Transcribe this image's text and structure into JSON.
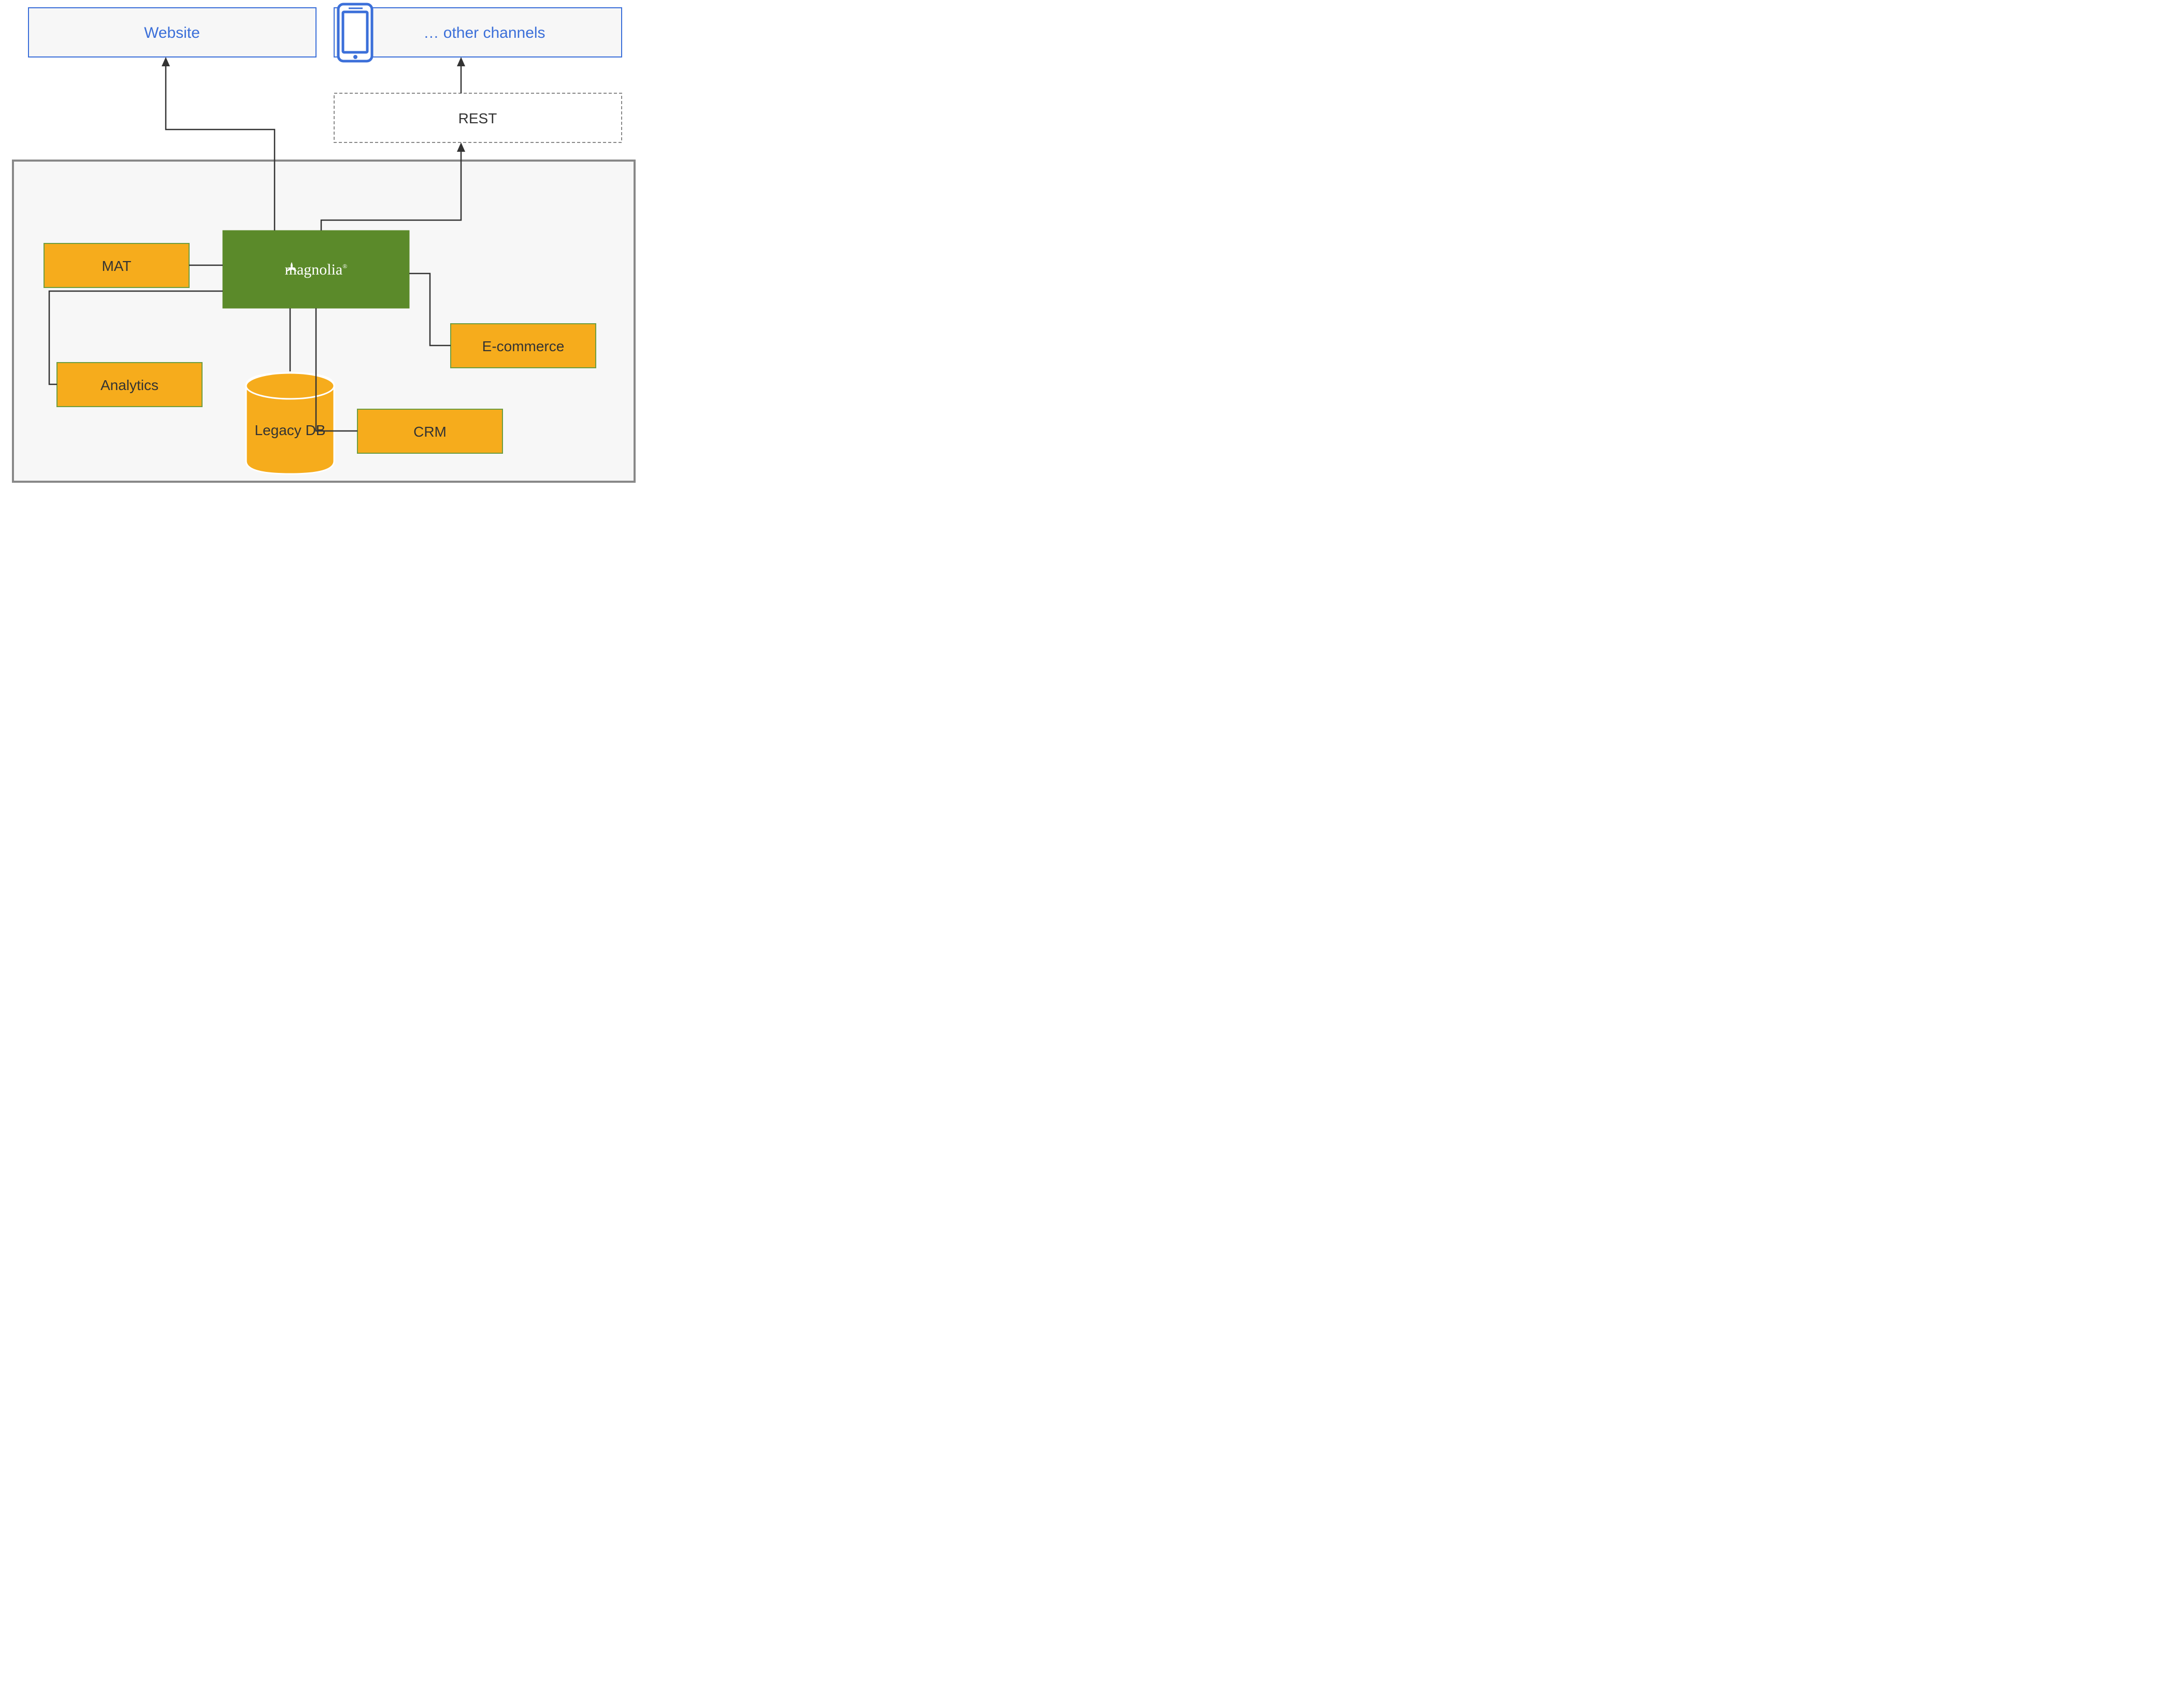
{
  "channels": {
    "website": "Website",
    "other": "… other channels"
  },
  "rest": "REST",
  "core": {
    "brand": "magnolia",
    "reg": "®"
  },
  "integrations": {
    "mat": "MAT",
    "analytics": "Analytics",
    "legacydb": "Legacy DB",
    "crm": "CRM",
    "ecommerce": "E-commerce"
  }
}
